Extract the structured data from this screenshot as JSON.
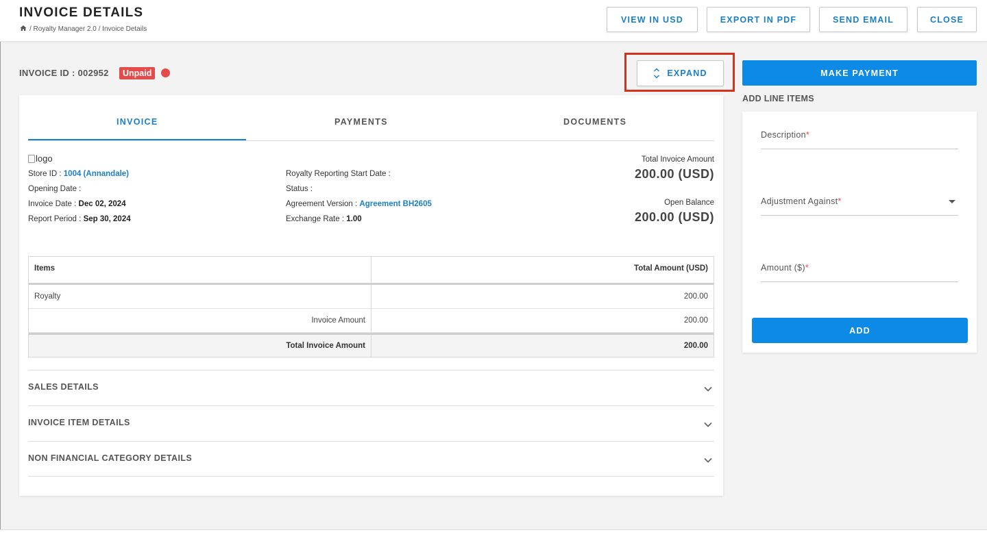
{
  "header": {
    "title": "INVOICE DETAILS",
    "breadcrumb": "/ Royalty Manager 2.0 / Invoice Details",
    "buttons": {
      "view_usd": "VIEW IN USD",
      "export_pdf": "EXPORT IN PDF",
      "send_email": "SEND EMAIL",
      "close": "CLOSE"
    }
  },
  "invoice": {
    "id_label": "INVOICE ID : 002952",
    "status_badge": "Unpaid",
    "status_color": "#e44c4c"
  },
  "expand_button": "EXPAND",
  "highlight_color": "#d4321c",
  "tabs": [
    "INVOICE",
    "PAYMENTS",
    "DOCUMENTS"
  ],
  "active_tab": "INVOICE",
  "details": {
    "logo_alt": "logo",
    "store_id_label": "Store ID :",
    "store_id_value": "1004 (Annandale)",
    "opening_date_label": "Opening Date :",
    "invoice_date_label": "Invoice Date :",
    "invoice_date_value": "Dec 02, 2024",
    "report_period_label": "Report Period :",
    "report_period_value": "Sep 30, 2024",
    "royalty_start_label": "Royalty Reporting Start Date :",
    "status_label": "Status :",
    "agreement_label": "Agreement Version :",
    "agreement_value": "Agreement BH2605",
    "exchange_label": "Exchange Rate :",
    "exchange_value": "1.00",
    "total_invoice_label": "Total Invoice Amount",
    "total_invoice_value": "200.00 (USD)",
    "open_balance_label": "Open Balance",
    "open_balance_value": "200.00 (USD)"
  },
  "items_table": {
    "headers": [
      "Items",
      "Total Amount (USD)"
    ],
    "rows": [
      {
        "item": "Royalty",
        "amount": "200.00"
      },
      {
        "item": "Invoice Amount",
        "amount": "200.00"
      }
    ],
    "total": {
      "label": "Total Invoice Amount",
      "amount": "200.00"
    }
  },
  "accordions": [
    "SALES DETAILS",
    "INVOICE ITEM DETAILS",
    "NON FINANCIAL CATEGORY DETAILS"
  ],
  "right_panel": {
    "make_payment": "MAKE PAYMENT",
    "title": "ADD LINE ITEMS",
    "fields": {
      "description": "Description",
      "adjustment": "Adjustment Against",
      "amount": "Amount ($)",
      "required_mark": "*"
    },
    "add_button": "ADD"
  },
  "colors": {
    "accent": "#1a7fc7",
    "primary_button": "#0d8ae6"
  }
}
